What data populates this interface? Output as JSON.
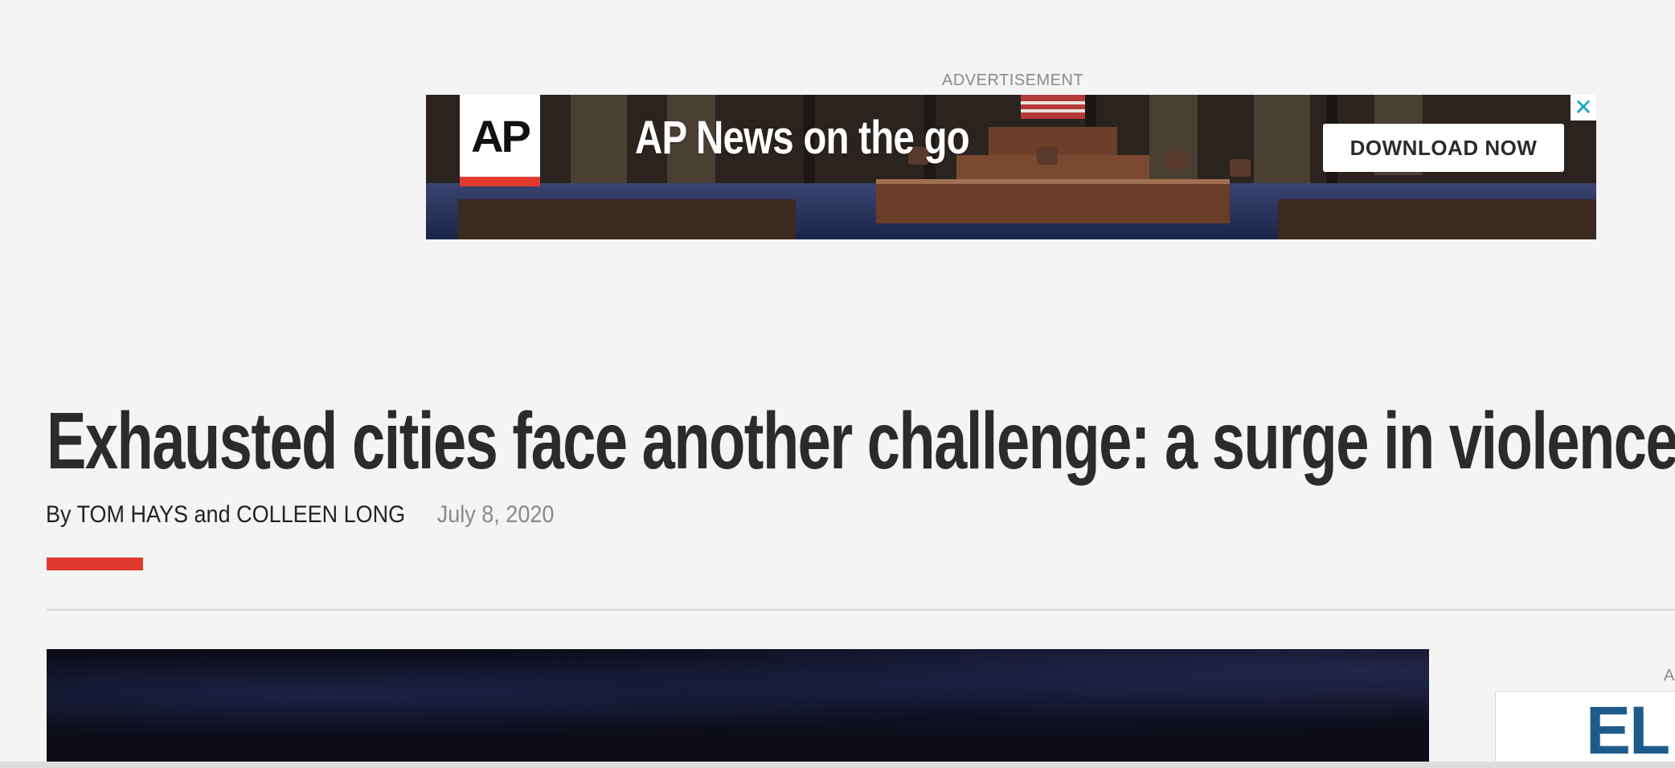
{
  "ad": {
    "label": "ADVERTISEMENT",
    "logo_text": "AP",
    "headline": "AP News on the go",
    "cta": "DOWNLOAD NOW",
    "close_glyph": "✕"
  },
  "article": {
    "headline": "Exhausted cities face another challenge: a surge in violence",
    "byline": "By TOM HAYS and COLLEEN LONG",
    "date": "July 8, 2020"
  },
  "side_ad": {
    "label": "A",
    "brand_text": "EL"
  },
  "colors": {
    "accent": "#e03a2f",
    "background": "#f4f4f4",
    "close_icon": "#1aa3c9",
    "side_brand": "#1f5b8a"
  },
  "icons": {
    "close": "close-icon"
  }
}
